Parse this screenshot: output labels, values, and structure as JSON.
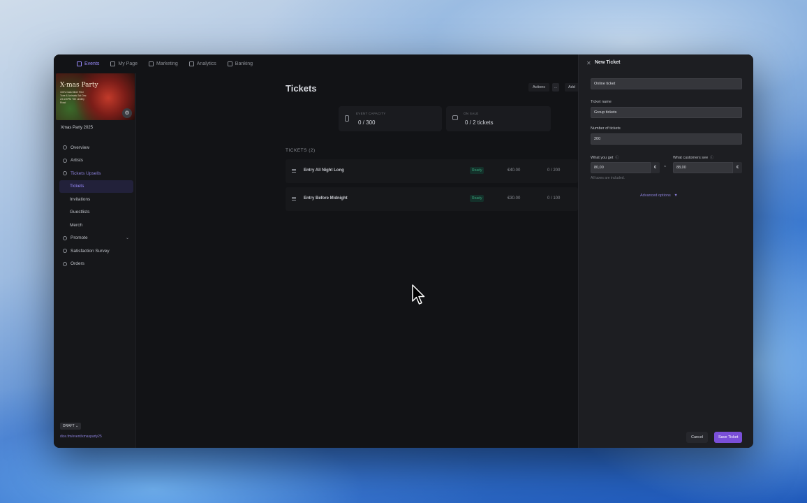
{
  "nav": {
    "items": [
      "Events",
      "My Page",
      "Marketing",
      "Analytics",
      "Banking"
    ]
  },
  "sidebar": {
    "image_title": "X-mas Party",
    "image_subtitle": "100's Gala Mixer\nRed Tone & Animals\nSat Dec 23 at 6PM\n+80 Lindley Road",
    "event_title": "Xmas Party 2025",
    "items": [
      {
        "label": "Overview"
      },
      {
        "label": "Artists"
      },
      {
        "label": "Tickets Upsells"
      },
      {
        "label": "Tickets"
      },
      {
        "label": "Invitations"
      },
      {
        "label": "Guestlists"
      },
      {
        "label": "Merch"
      },
      {
        "label": "Promote"
      },
      {
        "label": "Satisfaction Survey"
      },
      {
        "label": "Orders"
      }
    ],
    "draft_badge": "DRAFT",
    "event_url": "dice.fm/event/xmasparty25"
  },
  "main": {
    "title": "Tickets",
    "actions_label": "Actions",
    "more_label": "...",
    "add_label": "Add",
    "stats": [
      {
        "label": "EVENT CAPACITY",
        "value": "0  / 300"
      },
      {
        "label": "ON SALE",
        "value": "0 / 2 tickets"
      }
    ],
    "section_label": "TICKETS (2)",
    "tickets": [
      {
        "name": "Entry All Night Long",
        "status": "Ready",
        "price": "€40.00",
        "sold": "0 / 200"
      },
      {
        "name": "Entry Before Midnight",
        "status": "Ready",
        "price": "€30.00",
        "sold": "0 / 100"
      }
    ]
  },
  "panel": {
    "title": "New Ticket",
    "ticket_type_value": "Online ticket",
    "ticket_name_label": "Ticket name",
    "ticket_name_value": "Group tickets",
    "num_tickets_label": "Number of tickets",
    "num_tickets_value": "200",
    "what_you_get_label": "What you get",
    "what_you_get_value": "80,00",
    "customers_see_label": "What customers see",
    "customers_see_value": "88,00",
    "currency": "€",
    "approx": "≈",
    "fees_note": "All taxes are included.",
    "advanced_label": "Advanced options",
    "cancel_label": "Cancel",
    "save_label": "Save Ticket"
  }
}
